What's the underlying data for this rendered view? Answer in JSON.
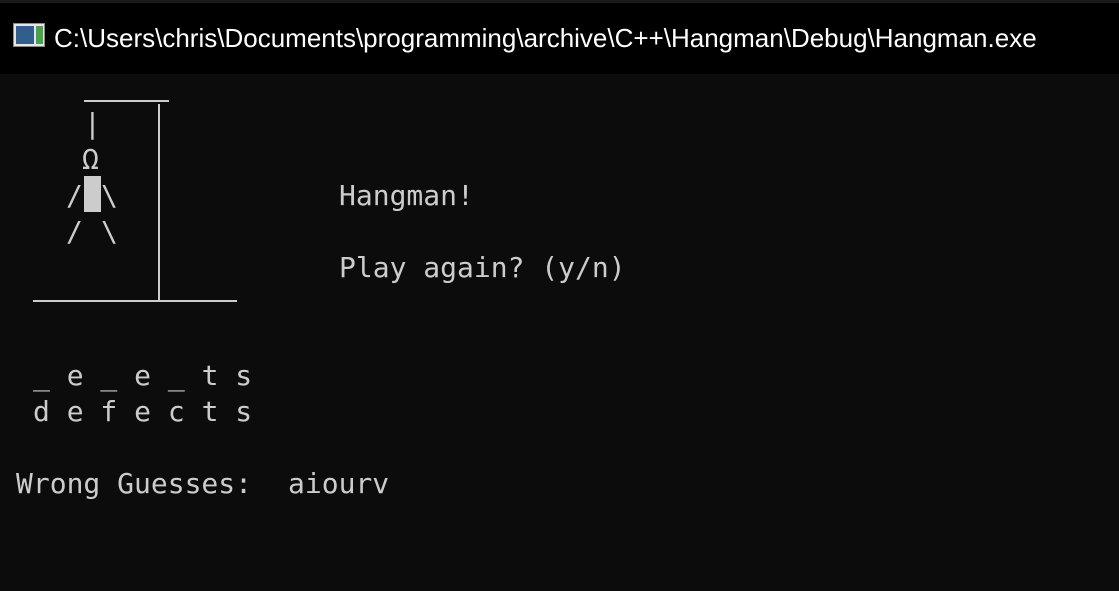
{
  "window": {
    "title": "C:\\Users\\chris\\Documents\\programming\\archive\\C++\\Hangman\\Debug\\Hangman.exe",
    "icon": "console-app-icon"
  },
  "gallows": {
    "rope": "|",
    "head": "Ω",
    "left_arm": "/",
    "right_arm": "\\",
    "left_leg": "/",
    "right_leg": "\\"
  },
  "messages": {
    "heading": "Hangman!",
    "prompt": "Play again? (y/n)"
  },
  "word": {
    "guessed_pattern": "_ e _ e _ t s",
    "answer": "d e f e c t s"
  },
  "wrong_guesses": {
    "label": "Wrong Guesses:",
    "letters": "aiourv"
  },
  "colors": {
    "background": "#0c0c0c",
    "foreground": "#cccccc",
    "titlebar": "#000000"
  }
}
